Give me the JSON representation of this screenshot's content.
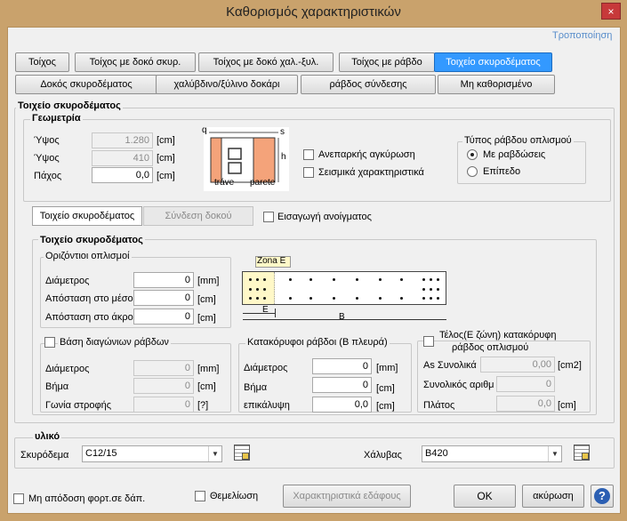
{
  "window": {
    "title": "Καθορισμός χαρακτηριστικών",
    "close": "×"
  },
  "modify_link": "Τροποποίηση",
  "type_tabs": [
    "Τοίχος",
    "Τοίχος με δοκό σκυρ.",
    "Τοίχος με δοκό χαλ.-ξυλ.",
    "Τοίχος με ράβδο",
    "Τοιχείο σκυροδέματος",
    "Δοκός σκυροδέματος",
    "χαλύβδινο/ξύλινο δοκάρι",
    "ράβδος σύνδεσης",
    "Μη καθορισμένο"
  ],
  "main_group": "Τοιχείο σκυροδέματος",
  "geometry": {
    "title": "Γεωμετρία",
    "fields": [
      {
        "label": "Ύψος",
        "value": "1.280",
        "unit": "[cm]"
      },
      {
        "label": "Ύψος",
        "value": "410",
        "unit": "[cm]"
      },
      {
        "label": "Πάχος",
        "value": "0,0",
        "unit": "[cm]"
      }
    ],
    "diagram_labels": {
      "q": "q",
      "s": "s",
      "h": "h",
      "trave": "tráve",
      "parete": "parete"
    },
    "checks": [
      "Ανεπαρκής αγκύρωση",
      "Σεισμικά χαρακτηριστικά"
    ],
    "rebar_type": {
      "title": "Τύπος ράβδου οπλισμού",
      "options": [
        "Με ραβδώσεις",
        "Επίπεδο"
      ],
      "selected": 0
    }
  },
  "subtabs": [
    "Τοιχείο σκυροδέματος",
    "Σύνδεση δοκού"
  ],
  "opening_check": "Εισαγωγή ανοίγματος",
  "wall_group": "Τοιχείο σκυροδέματος",
  "horizontal": {
    "title": "Οριζόντιοι οπλισμοί",
    "fields": [
      {
        "label": "Διάμετρος",
        "value": "0",
        "unit": "[mm]"
      },
      {
        "label": "Απόσταση στο μέσο",
        "value": "0",
        "unit": "[cm]"
      },
      {
        "label": "Απόσταση στο άκρο",
        "value": "0",
        "unit": "[cm]"
      }
    ]
  },
  "section_diagram": {
    "zone": "Zona E",
    "e": "E",
    "b": "B"
  },
  "diagonal": {
    "title": "Βάση διαγώνιων ράβδων",
    "fields": [
      {
        "label": "Διάμετρος",
        "value": "0",
        "unit": "[mm]"
      },
      {
        "label": "Βήμα",
        "value": "0",
        "unit": "[cm]"
      },
      {
        "label": "Γωνία στροφής",
        "value": "0",
        "unit": "[?]"
      }
    ]
  },
  "vertical": {
    "title": "Κατακόρυφοι ράβδοι (Β πλευρά)",
    "fields": [
      {
        "label": "Διάμετρος",
        "value": "0",
        "unit": "[mm]"
      },
      {
        "label": "Βήμα",
        "value": "0",
        "unit": "[cm]"
      },
      {
        "label": "επικάλυψη",
        "value": "0,0",
        "unit": "[cm]"
      }
    ]
  },
  "end_zone": {
    "title1": "Τέλος(Ε ζώνη) κατακόρυφη",
    "title2": "ράβδος οπλισμού",
    "fields": [
      {
        "label": "As Συνολικά",
        "value": "0,00",
        "unit": "[cm2]"
      },
      {
        "label": "Συνολικός αριθμ",
        "value": "0",
        "unit": ""
      },
      {
        "label": "Πλάτος",
        "value": "0,0",
        "unit": "[cm]"
      }
    ]
  },
  "material": {
    "title": "υλικό",
    "concrete_label": "Σκυρόδεμα",
    "concrete_value": "C12/15",
    "steel_label": "Χάλυβας",
    "steel_value": "B420"
  },
  "footer": {
    "no_load": "Μη απόδοση φορτ.σε δάπ.",
    "foundation": "Θεμελίωση",
    "soil": "Χαρακτηριστικά εδάφους",
    "ok": "OK",
    "cancel": "ακύρωση",
    "help": "?"
  },
  "colors": {
    "accent": "#3399ff",
    "frame": "#c9a26c",
    "diagram_fill": "#f4a37a",
    "zone_fill": "#fff8c8"
  }
}
